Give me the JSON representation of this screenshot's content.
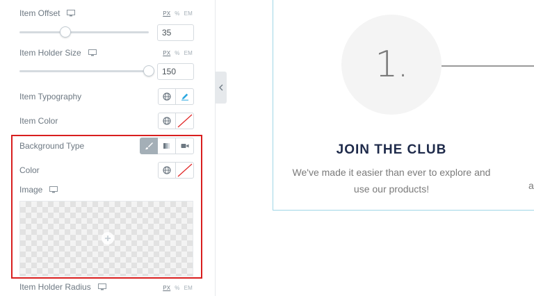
{
  "panel": {
    "item_offset": {
      "label": "Item Offset",
      "value": "35",
      "units": [
        "PX",
        "%",
        "EM"
      ],
      "active_unit": "PX"
    },
    "item_holder_size": {
      "label": "Item Holder Size",
      "value": "150",
      "units": [
        "PX",
        "%",
        "EM"
      ]
    },
    "item_typography": {
      "label": "Item Typography"
    },
    "item_color": {
      "label": "Item Color"
    },
    "background_type": {
      "label": "Background Type",
      "options": [
        "classic-brush-icon",
        "gradient-icon",
        "video-icon"
      ],
      "selected": 0
    },
    "color": {
      "label": "Color"
    },
    "image": {
      "label": "Image"
    },
    "item_holder_radius": {
      "label": "Item Holder Radius",
      "units": [
        "PX",
        "%",
        "EM"
      ]
    }
  },
  "preview": {
    "step_number": "1.",
    "title": "JOIN THE CLUB",
    "description_line1": "We've made it easier than ever to explore and",
    "description_line2": "use our products!",
    "next_card_peek": "a"
  },
  "colors": {
    "highlight": "#d81e1e",
    "card_border": "#9ed6e6",
    "title": "#1e2a4a"
  }
}
